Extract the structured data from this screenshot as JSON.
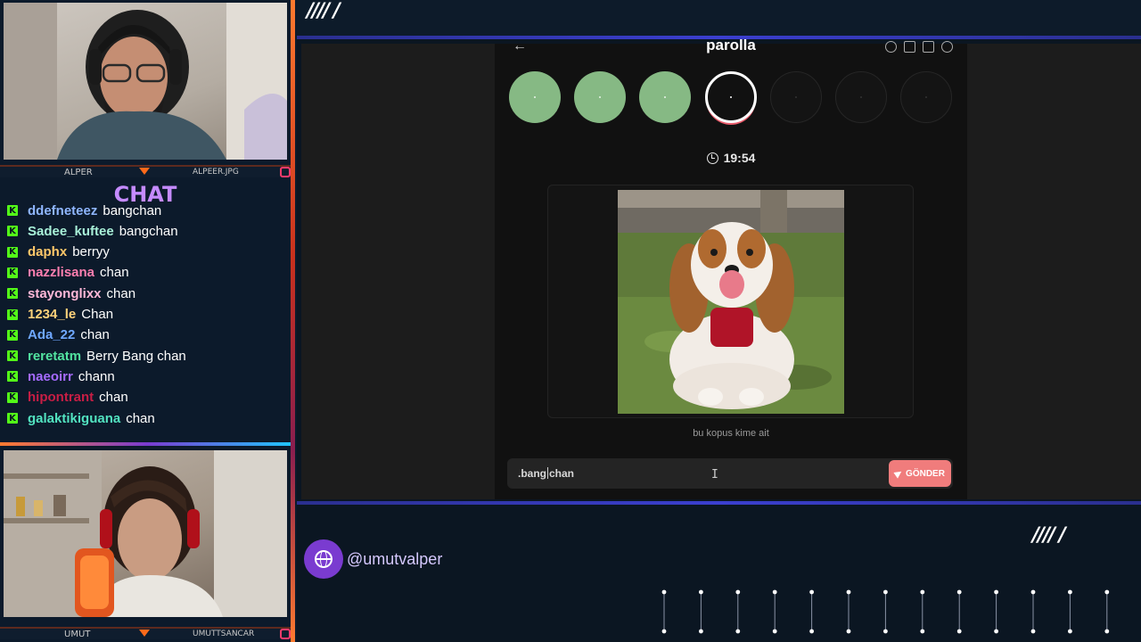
{
  "overlay": {
    "top_slashes": "//// /",
    "bottom_slashes": "//// /",
    "chat_title": "CHAT",
    "top_cam": {
      "left_name": "ALPER",
      "right_name": "ALPEER.JPG"
    },
    "bottom_cam": {
      "left_name": "UMUT",
      "right_name": "UMUTTSANCAR"
    },
    "social_handle": "@umutvalper",
    "colors": {
      "accent_purple": "#7a3bd0",
      "accent_orange": "#ff7a2f",
      "kick_green": "#53fc18"
    }
  },
  "chat": {
    "messages": [
      {
        "user": "ddefneteez",
        "text": "bangchan",
        "color": "#8fb6ff"
      },
      {
        "user": "Sadee_kuftee",
        "text": "bangchan",
        "color": "#a8f0d8"
      },
      {
        "user": "daphx",
        "text": "berryy",
        "color": "#ffc86a"
      },
      {
        "user": "nazzlisana",
        "text": "chan",
        "color": "#ff7fb0"
      },
      {
        "user": "stayonglixx",
        "text": "chan",
        "color": "#ffb8d8"
      },
      {
        "user": "1234_le",
        "text": "Chan",
        "color": "#ffd27a"
      },
      {
        "user": "Ada_22",
        "text": "chan",
        "color": "#6fa8ff"
      },
      {
        "user": "reretatm",
        "text": "Berry Bang chan",
        "color": "#52e3a0"
      },
      {
        "user": "naeoirr",
        "text": "chann",
        "color": "#a66bff"
      },
      {
        "user": "hipontrant",
        "text": "chan",
        "color": "#c81e45"
      },
      {
        "user": "galaktikiguana",
        "text": "chan",
        "color": "#52e3c0"
      }
    ]
  },
  "app": {
    "title": "parolla",
    "back_icon": "arrow-left-icon",
    "header_icons": [
      "info-icon",
      "chart-icon",
      "chat-icon",
      "user-icon"
    ],
    "progress": {
      "total": 7,
      "completed": 3,
      "current_index": 3
    },
    "timer": "19:54",
    "image_alt": "cavalier king charles spaniel dog on grass",
    "caption": "bu kopus kime ait",
    "input": {
      "value_before_caret": ".bang",
      "value_after_caret": "chan"
    },
    "send_label": "GÖNDER"
  }
}
